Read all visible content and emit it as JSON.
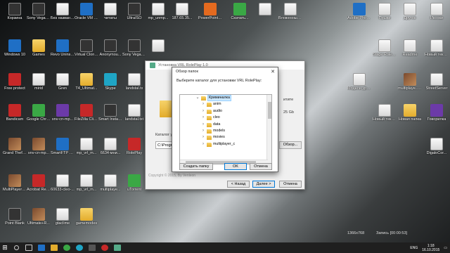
{
  "desktop_icons": [
    {
      "label": "Корзина",
      "color": "app-dark"
    },
    {
      "label": "Sony Vegas Pro 13.0",
      "color": "app-dark"
    },
    {
      "label": "Без названия",
      "color": "file"
    },
    {
      "label": "Oracle VM VirtualBox",
      "color": "app-blue"
    },
    {
      "label": "читаты",
      "color": "file"
    },
    {
      "label": "UltraISO",
      "color": "app-dark"
    },
    {
      "label": "mp_unmp...",
      "color": "file"
    },
    {
      "label": "187.65.35...",
      "color": "file"
    },
    {
      "label": "PowerPoint 2016",
      "color": "app-orange"
    },
    {
      "label": "Скачать...",
      "color": "app-green"
    },
    {
      "label": "",
      "color": "file"
    },
    {
      "label": "Вложенные аккаунты",
      "color": "file"
    },
    {
      "label": "Adobe Photosh...",
      "color": "app-blue"
    },
    {
      "label": "Пушки",
      "color": "file"
    },
    {
      "label": "Другое",
      "color": "file"
    },
    {
      "label": "Иконки",
      "color": "file"
    },
    {
      "label": "Новый текстовый...",
      "color": "file"
    },
    {
      "label": "Windows 10",
      "color": "app-blue"
    },
    {
      "label": "Games",
      "color": "folder"
    },
    {
      "label": "Revo Uninstall...",
      "color": "app-blue"
    },
    {
      "label": "Virtual CloneDrive",
      "color": "app-dark"
    },
    {
      "label": "Anonymou...",
      "color": "app-dark"
    },
    {
      "label": "Sony Vegas Pro 13.0 В",
      "color": "app-dark"
    },
    {
      "label": "",
      "color": "file"
    },
    {
      "label": "Stage RolePlay",
      "color": "file"
    },
    {
      "label": "Readme",
      "color": "file"
    },
    {
      "label": "StreetServer",
      "color": "file"
    },
    {
      "label": "Free protect",
      "color": "app-red"
    },
    {
      "label": "mirid",
      "color": "file"
    },
    {
      "label": "Gren",
      "color": "file"
    },
    {
      "label": "T4_Ultimat...",
      "color": "folder"
    },
    {
      "label": "Skype",
      "color": "app-cyan"
    },
    {
      "label": "landstal.tx",
      "color": "file"
    },
    {
      "label": "Модели урм в бетон",
      "color": "file"
    },
    {
      "label": "multiplaye...-армык",
      "color": "app-img"
    },
    {
      "label": "Говорилка",
      "color": "app-purple"
    },
    {
      "label": "Bandicam",
      "color": "app-red"
    },
    {
      "label": "Google Chrome",
      "color": "app-green"
    },
    {
      "label": "snv-сп-mp...",
      "color": "app-purple"
    },
    {
      "label": "FileZilla Client",
      "color": "app-red"
    },
    {
      "label": "Smart Install Maker",
      "color": "app-dark"
    },
    {
      "label": "landstal.txt",
      "color": "file"
    },
    {
      "label": "Новый текстов...",
      "color": "file"
    },
    {
      "label": "Новая папка",
      "color": "folder"
    },
    {
      "label": "DigaloCor...",
      "color": "file"
    },
    {
      "label": "Grand Theft Auto San...",
      "color": "app-img"
    },
    {
      "label": "snv-сп-mp...",
      "color": "app-img"
    },
    {
      "label": "SmartFTP Client",
      "color": "app-blue"
    },
    {
      "label": "mp_vrl_m...",
      "color": "file"
    },
    {
      "label": "6634-мни...",
      "color": "file"
    },
    {
      "label": "RolePlay",
      "color": "app-red"
    },
    {
      "label": "MultiPlayer [0.3e]",
      "color": "app-img"
    },
    {
      "label": "Acrobat Reader DC",
      "color": "app-red"
    },
    {
      "label": "60633-cleo-...",
      "color": "file"
    },
    {
      "label": "mp_vrl_m...",
      "color": "file"
    },
    {
      "label": "multiplaye...",
      "color": "file"
    },
    {
      "label": "uTorrent",
      "color": "app-green"
    },
    {
      "label": "Point Blank",
      "color": "app-dark"
    },
    {
      "label": "Ultimate+R...",
      "color": "app-img"
    },
    {
      "label": "gtaclime",
      "color": "file"
    },
    {
      "label": "gamemodes",
      "color": "folder"
    }
  ],
  "installer": {
    "title": "Установка VRL RolePlay 1.0",
    "side_text_1": "итите",
    "side_text_2": "25 Gb",
    "path_label": "Каталог ус...",
    "path_value": "C:\\Program...",
    "browse_label": "Обзор...",
    "copyright": "Copyright © 2015, By Venleon",
    "back_label": "< Назад",
    "next_label": "Далее >",
    "cancel_label": "Отмена"
  },
  "dialog": {
    "title": "Обзор папок",
    "prompt": "Выберите каталог для установки VRL RolePlay:",
    "tree": [
      {
        "label": "Криминалка",
        "level": 0,
        "expanded": true,
        "selected": true
      },
      {
        "label": "anim",
        "level": 1,
        "expanded": false,
        "selected": false
      },
      {
        "label": "audio",
        "level": 1,
        "expanded": false,
        "selected": false
      },
      {
        "label": "cleo",
        "level": 1,
        "expanded": false,
        "selected": false
      },
      {
        "label": "data",
        "level": 1,
        "expanded": false,
        "selected": false
      },
      {
        "label": "models",
        "level": 1,
        "expanded": false,
        "selected": false
      },
      {
        "label": "movies",
        "level": 1,
        "expanded": false,
        "selected": false
      },
      {
        "label": "multiplayer_c",
        "level": 1,
        "expanded": false,
        "selected": false
      }
    ],
    "new_folder_label": "Создать папку",
    "ok_label": "OK",
    "cancel_label": "Отмена"
  },
  "taskbar": {
    "resolution": "1366x768",
    "recording": "Запись [00:00:53]",
    "language": "ENG",
    "time": "1:18",
    "date": "16.10.2015"
  }
}
